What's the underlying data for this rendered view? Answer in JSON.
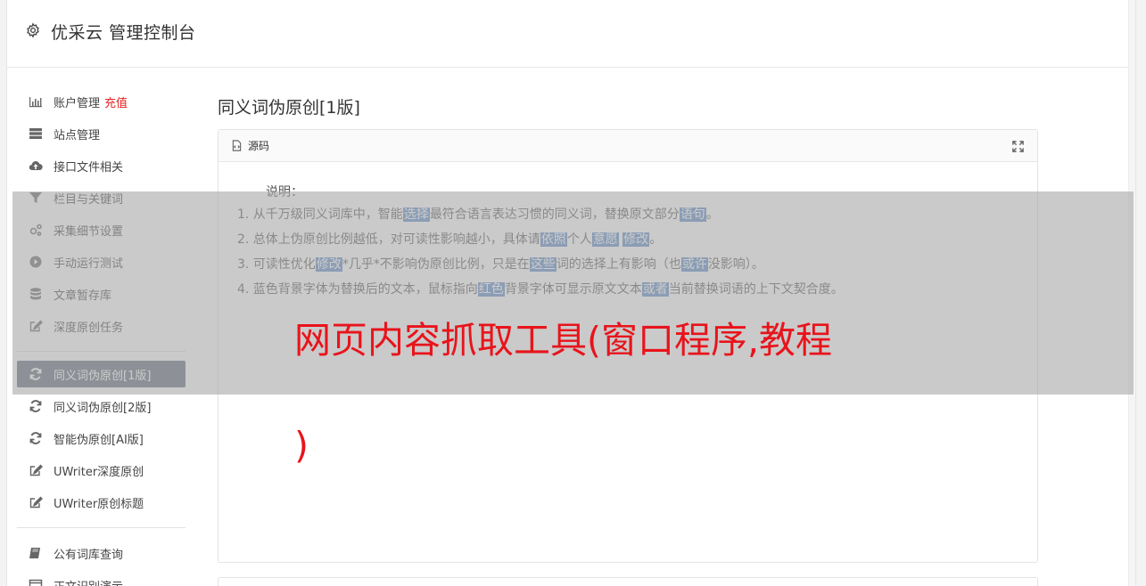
{
  "header": {
    "title": "优采云 管理控制台",
    "icon": "gear-icon"
  },
  "sidebar": {
    "group1": [
      {
        "label": "账户管理",
        "badge": "充值",
        "icon": "bar-chart-icon"
      },
      {
        "label": "站点管理",
        "icon": "server-icon"
      },
      {
        "label": "接口文件相关",
        "icon": "cloud-upload-icon"
      },
      {
        "label": "栏目与关键词",
        "icon": "filter-icon"
      },
      {
        "label": "采集细节设置",
        "icon": "gears-icon"
      },
      {
        "label": "手动运行测试",
        "icon": "play-circle-icon"
      },
      {
        "label": "文章暂存库",
        "icon": "database-icon"
      },
      {
        "label": "深度原创任务",
        "icon": "edit-icon"
      }
    ],
    "group2": [
      {
        "label": "同义词伪原创[1版]",
        "icon": "refresh-icon",
        "active": true
      },
      {
        "label": "同义词伪原创[2版]",
        "icon": "refresh-icon"
      },
      {
        "label": "智能伪原创[AI版]",
        "icon": "refresh-icon"
      },
      {
        "label": "UWriter深度原创",
        "icon": "edit-icon"
      },
      {
        "label": "UWriter原创标题",
        "icon": "edit-icon"
      }
    ],
    "group3": [
      {
        "label": "公有词库查询",
        "icon": "book-icon"
      },
      {
        "label": "正文识别演示",
        "icon": "window-icon"
      }
    ]
  },
  "main": {
    "heading": "同义词伪原创[1版]",
    "panel_title": "源码",
    "note_label": "说明：",
    "notes": [
      [
        {
          "t": "1. 从千万级同义词库中，智能"
        },
        {
          "t": "选择",
          "h": true
        },
        {
          "t": "最符合语言表达习惯的同义词，替换原文部分"
        },
        {
          "t": "语句",
          "h": true
        },
        {
          "t": "。"
        }
      ],
      [
        {
          "t": "2. 总体上伪原创比例越低，对可读性影响越小，具体请"
        },
        {
          "t": "依照",
          "h": true
        },
        {
          "t": "个人"
        },
        {
          "t": "意愿",
          "h": true
        },
        {
          "t": " "
        },
        {
          "t": "修改",
          "h": true
        },
        {
          "t": "。"
        }
      ],
      [
        {
          "t": "3. 可读性优化"
        },
        {
          "t": "修改",
          "h": true
        },
        {
          "t": "*几乎*不影响伪原创比例，只是在"
        },
        {
          "t": "这些",
          "h": true
        },
        {
          "t": "词的选择上有影响（也"
        },
        {
          "t": "或许",
          "h": true
        },
        {
          "t": "没影响）。"
        }
      ],
      [
        {
          "t": "4. 蓝色背景字体为替换后的文本，鼠标指向"
        },
        {
          "t": "红色",
          "h": true
        },
        {
          "t": "背景字体可显示原文文本"
        },
        {
          "t": "或者",
          "h": true
        },
        {
          "t": "当前替换词语的上下文契合度。"
        }
      ]
    ]
  },
  "overlay": {
    "line1": "网页内容抓取工具(窗口程序,教程",
    "line2": ")"
  },
  "colors": {
    "active_bg": "#5f6b79",
    "highlight": "#5b8ac8",
    "badge": "#e52222",
    "overlay_text": "#e8141b"
  }
}
